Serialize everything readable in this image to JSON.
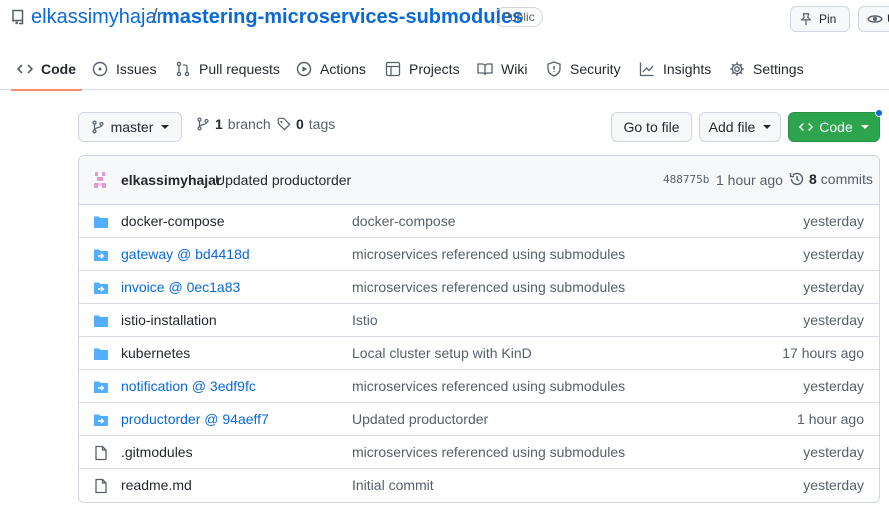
{
  "repo": {
    "owner": "elkassimyhajar",
    "separator": "/",
    "name": "mastering-microservices-submodules",
    "visibility": "Public",
    "pin_label": "Pin",
    "watch_label": "U"
  },
  "tabs": [
    {
      "label": "Code",
      "icon": "code-icon",
      "active": true
    },
    {
      "label": "Issues",
      "icon": "issue-opened-icon"
    },
    {
      "label": "Pull requests",
      "icon": "git-pull-request-icon"
    },
    {
      "label": "Actions",
      "icon": "play-icon"
    },
    {
      "label": "Projects",
      "icon": "table-icon"
    },
    {
      "label": "Wiki",
      "icon": "book-icon"
    },
    {
      "label": "Security",
      "icon": "shield-icon"
    },
    {
      "label": "Insights",
      "icon": "graph-icon"
    },
    {
      "label": "Settings",
      "icon": "gear-icon"
    }
  ],
  "toolbar": {
    "branch": "master",
    "branch_count": "1",
    "branch_word": "branch",
    "tag_count": "0",
    "tag_word": "tags",
    "go_to_file": "Go to file",
    "add_file": "Add file",
    "code": "Code",
    "accent": "#2da44e"
  },
  "commit": {
    "author": "elkassimyhajar",
    "message": "Updated productorder",
    "sha": "488775b",
    "time": "1 hour ago",
    "count": "8",
    "count_word": "commits"
  },
  "files": [
    {
      "name": "docker-compose",
      "type": "dir",
      "message": "docker-compose",
      "time": "yesterday"
    },
    {
      "name": "gateway @ bd4418d",
      "type": "submodule",
      "message": "microservices referenced using submodules",
      "time": "yesterday"
    },
    {
      "name": "invoice @ 0ec1a83",
      "type": "submodule",
      "message": "microservices referenced using submodules",
      "time": "yesterday"
    },
    {
      "name": "istio-installation",
      "type": "dir",
      "message": "Istio",
      "time": "yesterday"
    },
    {
      "name": "kubernetes",
      "type": "dir",
      "message": "Local cluster setup with KinD",
      "time": "17 hours ago"
    },
    {
      "name": "notification @ 3edf9fc",
      "type": "submodule",
      "message": "microservices referenced using submodules",
      "time": "yesterday"
    },
    {
      "name": "productorder @ 94aeff7",
      "type": "submodule",
      "message": "Updated productorder",
      "time": "1 hour ago"
    },
    {
      "name": ".gitmodules",
      "type": "file",
      "message": "microservices referenced using submodules",
      "time": "yesterday"
    },
    {
      "name": "readme.md",
      "type": "file",
      "message": "Initial commit",
      "time": "yesterday"
    }
  ]
}
